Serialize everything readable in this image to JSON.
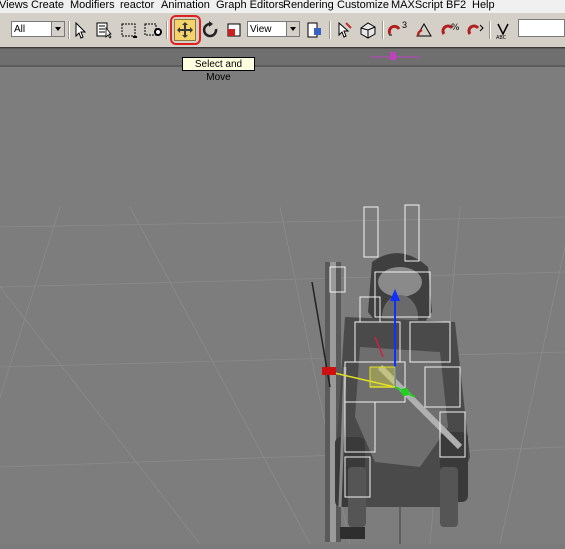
{
  "menu": {
    "items": [
      "Views",
      "Create",
      "Modifiers",
      "reactor",
      "Animation",
      "Graph Editors",
      "Rendering",
      "Customize",
      "MAXScript",
      "BF2",
      "Help"
    ]
  },
  "toolbar": {
    "selection_filter": "All",
    "reference_coord": "View",
    "snap_angle_label": "3",
    "selected_tool": "Select and Move"
  },
  "tooltip": {
    "text": "Select and Move"
  },
  "colors": {
    "highlight": "#e02020",
    "tool_active": "#f5d36b",
    "viewport_bg": "#7d7d7d"
  }
}
